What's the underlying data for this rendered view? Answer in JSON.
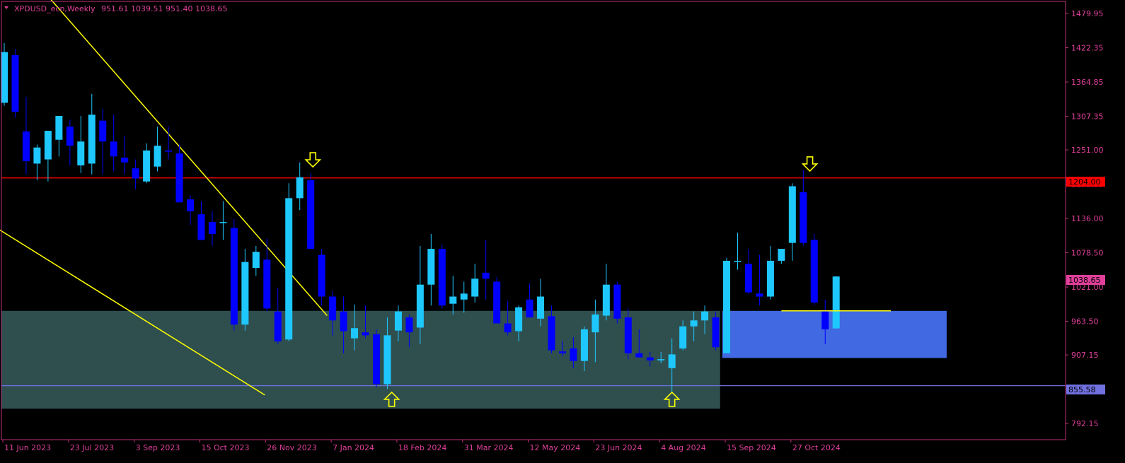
{
  "header": {
    "symbol": "XPDUSD_ecn,Weekly",
    "ohlc": "951.61 1039.51 951.40 1038.65"
  },
  "colors": {
    "background": "#000000",
    "frame": "#c0307a",
    "text": "#e0409a",
    "bull_candle": "#1ec8ff",
    "bear_candle": "#0000ff",
    "trendline": "#ffff00",
    "resistance_line": "#ff0000",
    "support_line": "#7070e0",
    "demand_zone": "#2f4f4f",
    "recent_zone": "#4169e1",
    "arrow": "#ffff00",
    "price_tag_current": "#e0409a",
    "price_tag_support": "#7070e0"
  },
  "price_tags": {
    "resistance": "1204.00",
    "current": "1038.65",
    "support": "855.58"
  },
  "chart_data": {
    "type": "candlestick",
    "timeframe": "Weekly",
    "ylim": [
      765,
      1500
    ],
    "y_ticks": [
      "1479.95",
      "1422.35",
      "1364.85",
      "1307.35",
      "1251.00",
      "1193.50",
      "1136.00",
      "1078.50",
      "1021.00",
      "963.50",
      "907.15",
      "849.65",
      "792.15"
    ],
    "x_ticks": [
      "11 Jun 2023",
      "23 Jul 2023",
      "3 Sep 2023",
      "15 Oct 2023",
      "26 Nov 2023",
      "7 Jan 2024",
      "18 Feb 2024",
      "31 Mar 2024",
      "12 May 2024",
      "23 Jun 2024",
      "4 Aug 2024",
      "15 Sep 2024",
      "27 Oct 2024"
    ],
    "candles": [
      {
        "o": 1330,
        "h": 1430,
        "l": 1325,
        "c": 1415
      },
      {
        "o": 1410,
        "h": 1420,
        "l": 1305,
        "c": 1315
      },
      {
        "o": 1282,
        "h": 1340,
        "l": 1210,
        "c": 1232
      },
      {
        "o": 1228,
        "h": 1260,
        "l": 1200,
        "c": 1255
      },
      {
        "o": 1235,
        "h": 1282,
        "l": 1198,
        "c": 1283
      },
      {
        "o": 1268,
        "h": 1305,
        "l": 1240,
        "c": 1308
      },
      {
        "o": 1290,
        "h": 1302,
        "l": 1225,
        "c": 1258
      },
      {
        "o": 1225,
        "h": 1308,
        "l": 1212,
        "c": 1265
      },
      {
        "o": 1228,
        "h": 1345,
        "l": 1210,
        "c": 1310
      },
      {
        "o": 1300,
        "h": 1320,
        "l": 1210,
        "c": 1265
      },
      {
        "o": 1265,
        "h": 1310,
        "l": 1215,
        "c": 1240
      },
      {
        "o": 1238,
        "h": 1275,
        "l": 1210,
        "c": 1230
      },
      {
        "o": 1220,
        "h": 1235,
        "l": 1185,
        "c": 1203
      },
      {
        "o": 1198,
        "h": 1262,
        "l": 1195,
        "c": 1250
      },
      {
        "o": 1223,
        "h": 1290,
        "l": 1215,
        "c": 1258
      },
      {
        "o": 1250,
        "h": 1290,
        "l": 1235,
        "c": 1248
      },
      {
        "o": 1245,
        "h": 1260,
        "l": 1165,
        "c": 1163
      },
      {
        "o": 1168,
        "h": 1175,
        "l": 1125,
        "c": 1148
      },
      {
        "o": 1143,
        "h": 1165,
        "l": 1102,
        "c": 1100
      },
      {
        "o": 1130,
        "h": 1148,
        "l": 1090,
        "c": 1110
      },
      {
        "o": 1130,
        "h": 1165,
        "l": 1100,
        "c": 1130
      },
      {
        "o": 1120,
        "h": 1135,
        "l": 948,
        "c": 958
      },
      {
        "o": 958,
        "h": 1085,
        "l": 948,
        "c": 1063
      },
      {
        "o": 1053,
        "h": 1090,
        "l": 1040,
        "c": 1080
      },
      {
        "o": 1067,
        "h": 1102,
        "l": 980,
        "c": 985
      },
      {
        "o": 980,
        "h": 1020,
        "l": 925,
        "c": 930
      },
      {
        "o": 933,
        "h": 1195,
        "l": 930,
        "c": 1170
      },
      {
        "o": 1170,
        "h": 1230,
        "l": 1150,
        "c": 1205
      },
      {
        "o": 1200,
        "h": 1212,
        "l": 1085,
        "c": 1085
      },
      {
        "o": 1075,
        "h": 1085,
        "l": 990,
        "c": 1005
      },
      {
        "o": 1005,
        "h": 1015,
        "l": 940,
        "c": 965
      },
      {
        "o": 980,
        "h": 1005,
        "l": 910,
        "c": 947
      },
      {
        "o": 935,
        "h": 992,
        "l": 915,
        "c": 952
      },
      {
        "o": 945,
        "h": 990,
        "l": 935,
        "c": 940
      },
      {
        "o": 942,
        "h": 950,
        "l": 853,
        "c": 858
      },
      {
        "o": 858,
        "h": 970,
        "l": 850,
        "c": 940
      },
      {
        "o": 948,
        "h": 990,
        "l": 930,
        "c": 980
      },
      {
        "o": 970,
        "h": 975,
        "l": 920,
        "c": 945
      },
      {
        "o": 953,
        "h": 1090,
        "l": 925,
        "c": 1025
      },
      {
        "o": 1025,
        "h": 1110,
        "l": 990,
        "c": 1085
      },
      {
        "o": 1085,
        "h": 1092,
        "l": 985,
        "c": 990
      },
      {
        "o": 993,
        "h": 1040,
        "l": 975,
        "c": 1005
      },
      {
        "o": 1000,
        "h": 1030,
        "l": 978,
        "c": 1010
      },
      {
        "o": 1005,
        "h": 1060,
        "l": 995,
        "c": 1035
      },
      {
        "o": 1045,
        "h": 1100,
        "l": 1000,
        "c": 1035
      },
      {
        "o": 1030,
        "h": 1038,
        "l": 960,
        "c": 960
      },
      {
        "o": 960,
        "h": 998,
        "l": 940,
        "c": 945
      },
      {
        "o": 947,
        "h": 990,
        "l": 930,
        "c": 987
      },
      {
        "o": 1000,
        "h": 1027,
        "l": 975,
        "c": 970
      },
      {
        "o": 968,
        "h": 1035,
        "l": 955,
        "c": 1005
      },
      {
        "o": 972,
        "h": 990,
        "l": 910,
        "c": 915
      },
      {
        "o": 913,
        "h": 930,
        "l": 905,
        "c": 910
      },
      {
        "o": 918,
        "h": 937,
        "l": 885,
        "c": 897
      },
      {
        "o": 897,
        "h": 955,
        "l": 880,
        "c": 950
      },
      {
        "o": 945,
        "h": 1000,
        "l": 895,
        "c": 975
      },
      {
        "o": 973,
        "h": 1060,
        "l": 965,
        "c": 1025
      },
      {
        "o": 1025,
        "h": 1030,
        "l": 960,
        "c": 968
      },
      {
        "o": 970,
        "h": 985,
        "l": 900,
        "c": 910
      },
      {
        "o": 910,
        "h": 950,
        "l": 903,
        "c": 903
      },
      {
        "o": 903,
        "h": 912,
        "l": 888,
        "c": 898
      },
      {
        "o": 898,
        "h": 912,
        "l": 893,
        "c": 900
      },
      {
        "o": 885,
        "h": 935,
        "l": 845,
        "c": 908
      },
      {
        "o": 918,
        "h": 965,
        "l": 915,
        "c": 955
      },
      {
        "o": 955,
        "h": 980,
        "l": 930,
        "c": 965
      },
      {
        "o": 965,
        "h": 990,
        "l": 942,
        "c": 980
      },
      {
        "o": 970,
        "h": 980,
        "l": 915,
        "c": 920
      },
      {
        "o": 910,
        "h": 1070,
        "l": 910,
        "c": 1065
      },
      {
        "o": 1065,
        "h": 1112,
        "l": 1050,
        "c": 1065
      },
      {
        "o": 1060,
        "h": 1085,
        "l": 1010,
        "c": 1012
      },
      {
        "o": 1010,
        "h": 1075,
        "l": 990,
        "c": 1005
      },
      {
        "o": 1005,
        "h": 1090,
        "l": 1000,
        "c": 1065
      },
      {
        "o": 1065,
        "h": 1085,
        "l": 1060,
        "c": 1085
      },
      {
        "o": 1095,
        "h": 1195,
        "l": 1065,
        "c": 1190
      },
      {
        "o": 1180,
        "h": 1217,
        "l": 1090,
        "c": 1095
      },
      {
        "o": 1100,
        "h": 1110,
        "l": 990,
        "c": 995
      },
      {
        "o": 980,
        "h": 1000,
        "l": 925,
        "c": 950
      },
      {
        "o": 951.61,
        "h": 1039.51,
        "l": 951.4,
        "c": 1038.65
      }
    ],
    "horizontal_lines": [
      {
        "price": 1204.0,
        "color": "#ff0000"
      },
      {
        "price": 855.58,
        "color": "#7070e0"
      }
    ],
    "short_line": {
      "price": 981,
      "from_candle": 71,
      "to_candle": 81
    },
    "zones": [
      {
        "from_candle": -1,
        "to_candle": 65.4,
        "top": 981,
        "bottom": 817,
        "color": "#2f4f4f"
      },
      {
        "from_candle": 65.6,
        "to_candle": 86.1,
        "top": 981,
        "bottom": 902,
        "color": "#4169e1"
      }
    ],
    "trendlines": [
      {
        "c1": 3.7,
        "p1": 1515,
        "c2": 29.5,
        "p2": 973
      },
      {
        "c1": -0.7,
        "p1": 1120,
        "c2": 23.8,
        "p2": 840
      }
    ],
    "arrows": [
      {
        "candle": 28.2,
        "price": 1232,
        "dir": "down"
      },
      {
        "candle": 35.4,
        "price": 835,
        "dir": "up"
      },
      {
        "candle": 61.0,
        "price": 835,
        "dir": "up"
      },
      {
        "candle": 73.6,
        "price": 1225,
        "dir": "down"
      }
    ]
  }
}
